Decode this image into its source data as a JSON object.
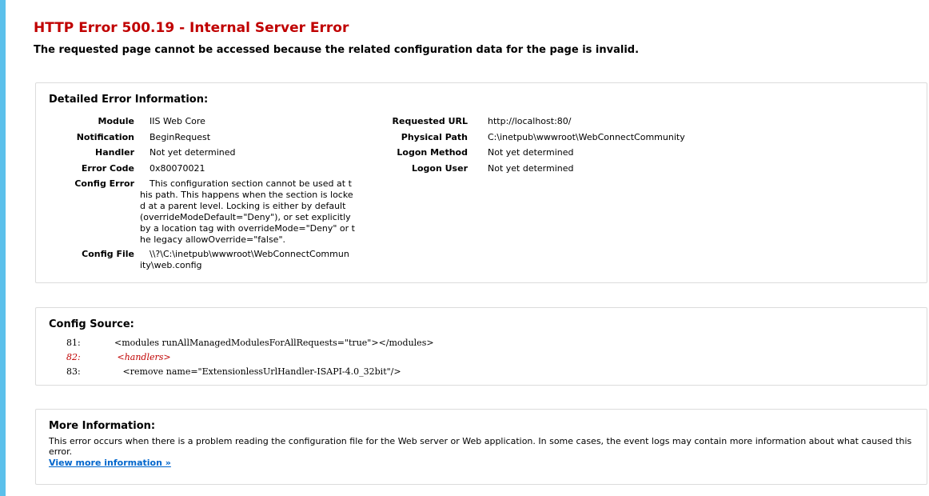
{
  "error": {
    "title": "HTTP Error 500.19 - Internal Server Error",
    "subtitle": "The requested page cannot be accessed because the related configuration data for the page is invalid."
  },
  "detail": {
    "heading": "Detailed Error Information:",
    "left": [
      {
        "label": "Module",
        "value": "IIS Web Core"
      },
      {
        "label": "Notification",
        "value": "BeginRequest"
      },
      {
        "label": "Handler",
        "value": "Not yet determined"
      },
      {
        "label": "Error Code",
        "value": "0x80070021"
      }
    ],
    "config_error": {
      "label": "Config Error",
      "value": "This configuration section cannot be used at this path. This happens when the section is locked at a parent level. Locking is either by default (overrideModeDefault=\"Deny\"), or set explicitly by a location tag with overrideMode=\"Deny\" or the legacy allowOverride=\"false\"."
    },
    "config_file": {
      "label": "Config File",
      "value": "\\\\?\\C:\\inetpub\\wwwroot\\WebConnectCommunity\\web.config"
    },
    "right": [
      {
        "label": "Requested URL",
        "value": "http://localhost:80/"
      },
      {
        "label": "Physical Path",
        "value": "C:\\inetpub\\wwwroot\\WebConnectCommunity"
      },
      {
        "label": "Logon Method",
        "value": "Not yet determined"
      },
      {
        "label": "Logon User",
        "value": "Not yet determined"
      }
    ]
  },
  "source": {
    "heading": "Config Source:",
    "lines": [
      {
        "num": "81:",
        "code": "  <modules runAllManagedModulesForAllRequests=\"true\"></modules>"
      },
      {
        "num": "82:",
        "code": "   <handlers>"
      },
      {
        "num": "83:",
        "code": "     <remove name=\"ExtensionlessUrlHandler-ISAPI-4.0_32bit\"/>"
      }
    ]
  },
  "more": {
    "heading": "More Information:",
    "text": "This error occurs when there is a problem reading the configuration file for the Web server or Web application. In some cases, the event logs may contain more information about what caused this error.",
    "link": "View more information »"
  },
  "colors": {
    "title": "#c00000",
    "link": "#0066cc",
    "accent_bar": "#5bc0eb"
  }
}
